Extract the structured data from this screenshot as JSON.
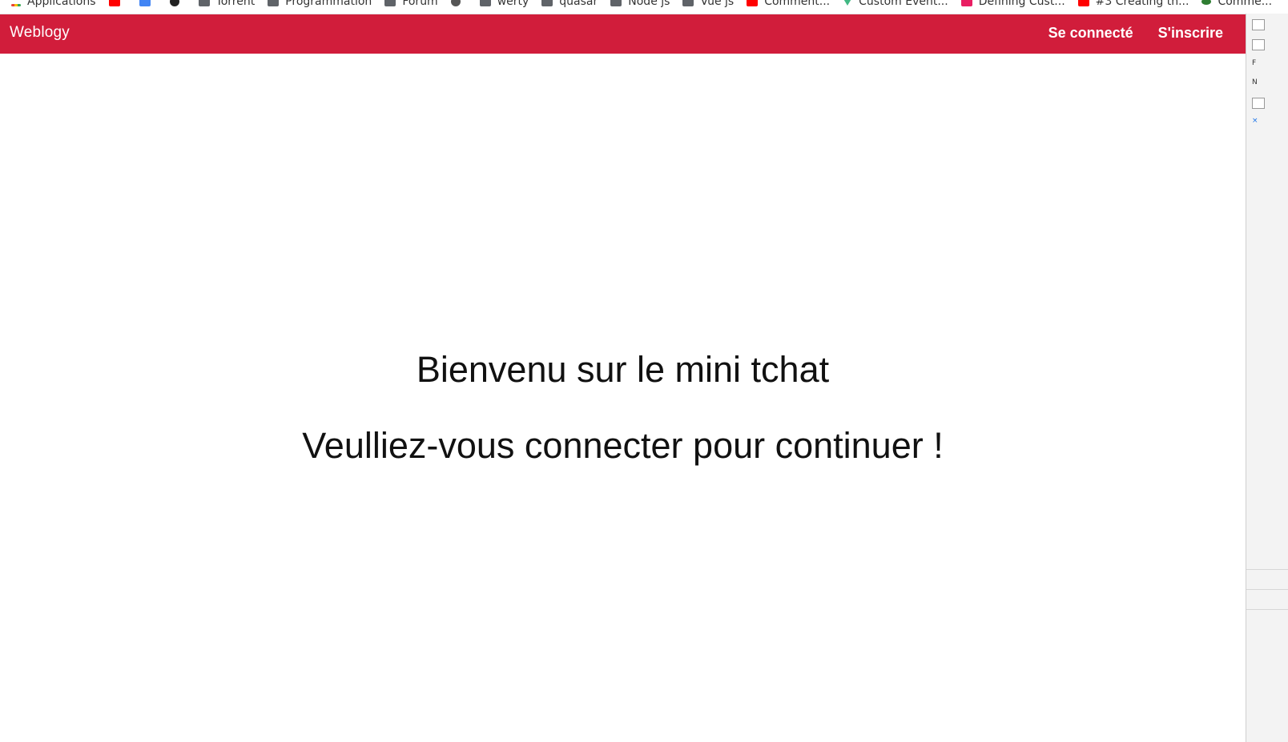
{
  "bookmarks": [
    {
      "label": "Applications",
      "icon": "apps-icon"
    },
    {
      "label": "",
      "icon": "youtube-icon"
    },
    {
      "label": "",
      "icon": "translate-icon"
    },
    {
      "label": "",
      "icon": "circle-icon"
    },
    {
      "label": "Torrent",
      "icon": "folder-icon"
    },
    {
      "label": "Programmation",
      "icon": "folder-icon"
    },
    {
      "label": "Forum",
      "icon": "folder-icon"
    },
    {
      "label": "",
      "icon": "gear-icon"
    },
    {
      "label": "werty",
      "icon": "folder-icon"
    },
    {
      "label": "quasar",
      "icon": "folder-icon"
    },
    {
      "label": "Node js",
      "icon": "folder-icon"
    },
    {
      "label": "Vue js",
      "icon": "folder-icon"
    },
    {
      "label": "Comment...",
      "icon": "youtube-icon"
    },
    {
      "label": "Custom Event...",
      "icon": "vue-icon"
    },
    {
      "label": "Defining Cust...",
      "icon": "pink-icon"
    },
    {
      "label": "#3 Creating th...",
      "icon": "youtube-icon"
    },
    {
      "label": "Comme...",
      "icon": "green-icon"
    }
  ],
  "navbar": {
    "brand": "Weblogy",
    "login_label": "Se connecté",
    "signup_label": "S'inscrire",
    "color": "#d11d3b"
  },
  "main": {
    "welcome": "Bienvenu sur le mini tchat",
    "prompt": "Veulliez-vous connecter pour continuer !"
  }
}
